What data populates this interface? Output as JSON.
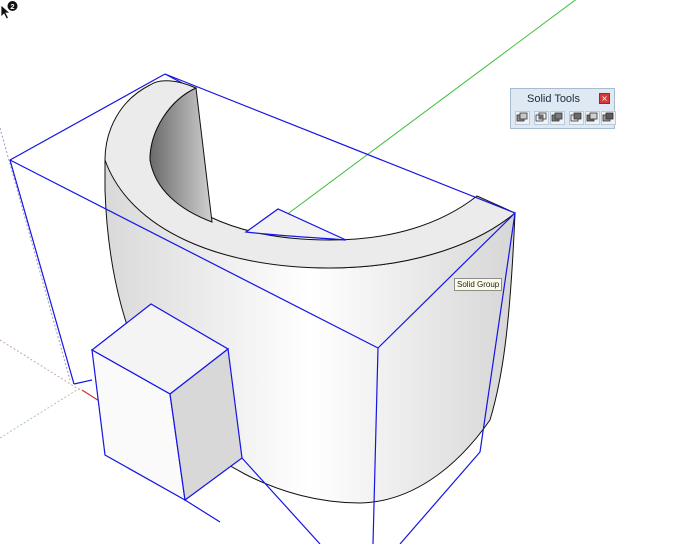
{
  "toolbar": {
    "title": "Solid Tools",
    "close_glyph": "×",
    "tools": [
      {
        "name": "outer-shell",
        "icon": "outer-shell-icon"
      },
      {
        "name": "intersect",
        "icon": "intersect-icon"
      },
      {
        "name": "union",
        "icon": "union-icon"
      },
      {
        "name": "subtract",
        "icon": "subtract-icon"
      },
      {
        "name": "trim",
        "icon": "trim-icon"
      },
      {
        "name": "split",
        "icon": "split-icon"
      }
    ]
  },
  "cursor": {
    "badge": "2",
    "tooltip": "Solid Group"
  },
  "colors": {
    "selection_box": "#1414e6",
    "green_axis": "#3cbd3c",
    "red_axis": "#c83232",
    "close_button": "#d9393a",
    "toolbar_bg": "#dfe9f3"
  }
}
